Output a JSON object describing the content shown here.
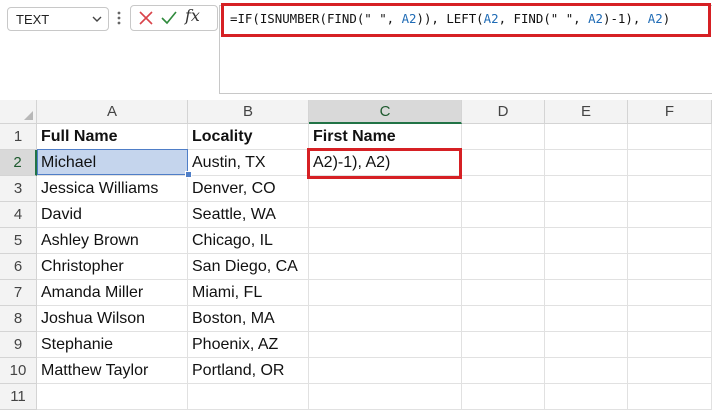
{
  "name_box": {
    "value": "TEXT"
  },
  "formula_bar": {
    "parts": [
      {
        "text": "=IF(ISNUMBER(FIND(\" \", ",
        "ref": false
      },
      {
        "text": "A2",
        "ref": true
      },
      {
        "text": ")), LEFT(",
        "ref": false
      },
      {
        "text": "A2",
        "ref": true
      },
      {
        "text": ", FIND(\" \", ",
        "ref": false
      },
      {
        "text": "A2",
        "ref": true
      },
      {
        "text": ")-1), ",
        "ref": false
      },
      {
        "text": "A2",
        "ref": true
      },
      {
        "text": ")",
        "ref": false
      }
    ],
    "fx_label": "fx"
  },
  "icons": [
    "chevron-down-icon",
    "more-vertical-icon",
    "cancel-x-icon",
    "enter-check-icon",
    "insert-function-icon"
  ],
  "colors": {
    "accent_green": "#217346",
    "highlight_red": "#d62024",
    "cell_ref_blue": "#1f6bb5",
    "selection_fill": "#c5d5ed"
  },
  "columns": [
    "A",
    "B",
    "C",
    "D",
    "E",
    "F"
  ],
  "rows": [
    "1",
    "2",
    "3",
    "4",
    "5",
    "6",
    "7",
    "8",
    "9",
    "10",
    "11"
  ],
  "grid": [
    [
      "Full Name",
      "Locality",
      "First Name"
    ],
    [
      "Michael",
      "Austin, TX",
      "A2)-1), A2)"
    ],
    [
      "Jessica Williams",
      "Denver, CO",
      ""
    ],
    [
      "David",
      "Seattle, WA",
      ""
    ],
    [
      "Ashley Brown",
      "Chicago, IL",
      ""
    ],
    [
      "Christopher",
      "San Diego, CA",
      ""
    ],
    [
      "Amanda Miller",
      "Miami, FL",
      ""
    ],
    [
      "Joshua Wilson",
      "Boston, MA",
      ""
    ],
    [
      "Stephanie",
      "Phoenix, AZ",
      ""
    ],
    [
      "Matthew Taylor",
      "Portland, OR",
      ""
    ],
    [
      "",
      "",
      ""
    ]
  ],
  "selection": {
    "highlighted_cell": "A2",
    "active_cell": "C2"
  }
}
